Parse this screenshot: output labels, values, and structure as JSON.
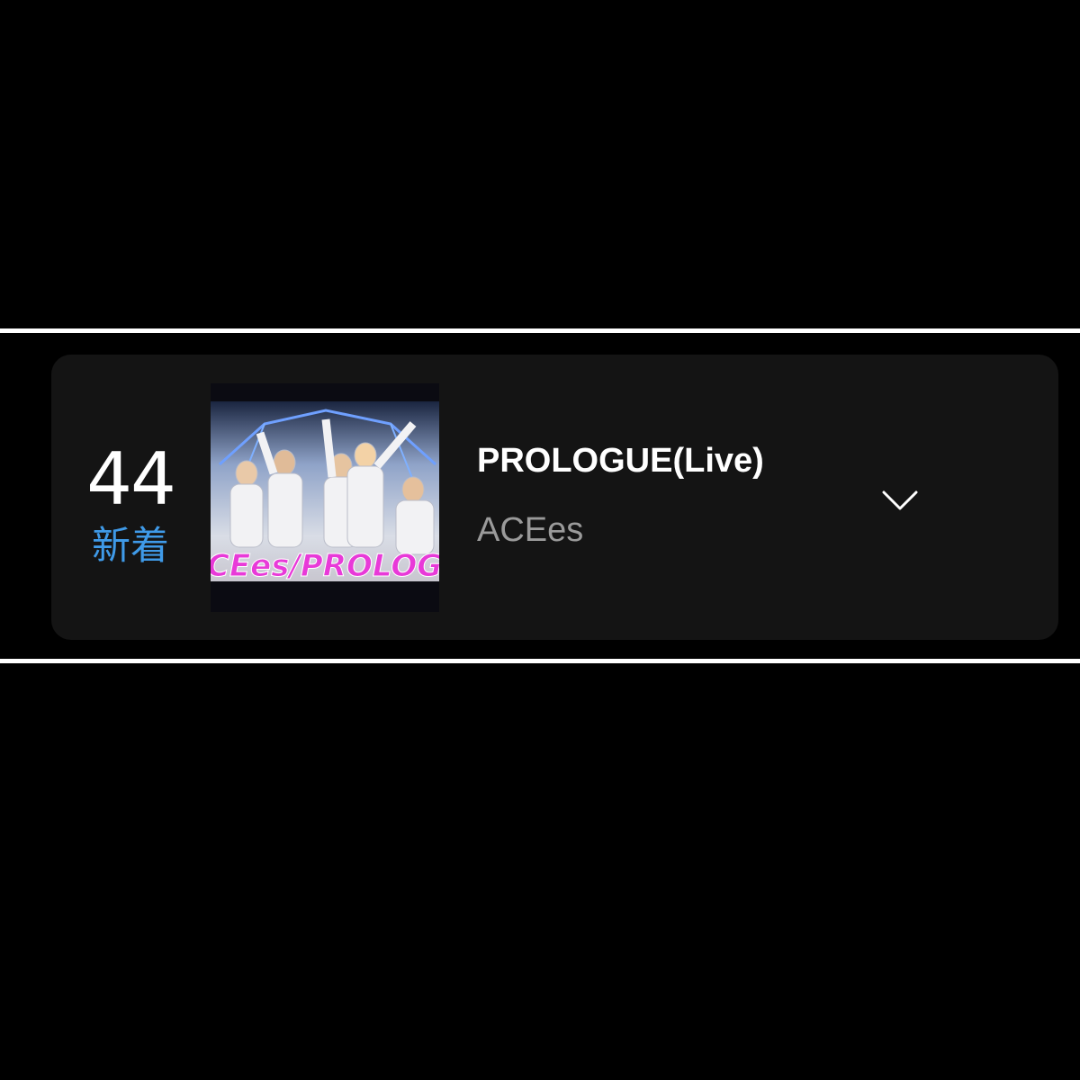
{
  "chart_entry": {
    "rank": "44",
    "status": "新着",
    "song_title": "PROLOGUE(Live)",
    "artist": "ACEes",
    "thumbnail_caption": "CEes/PROLOGU",
    "expand_icon": "chevron-down-icon"
  },
  "colors": {
    "background": "#000000",
    "card": "#141414",
    "divider": "#ffffff",
    "status_new": "#3f9ae8",
    "title": "#ffffff",
    "artist": "#9a9a9a",
    "thumb_caption": "#e83ad8"
  }
}
